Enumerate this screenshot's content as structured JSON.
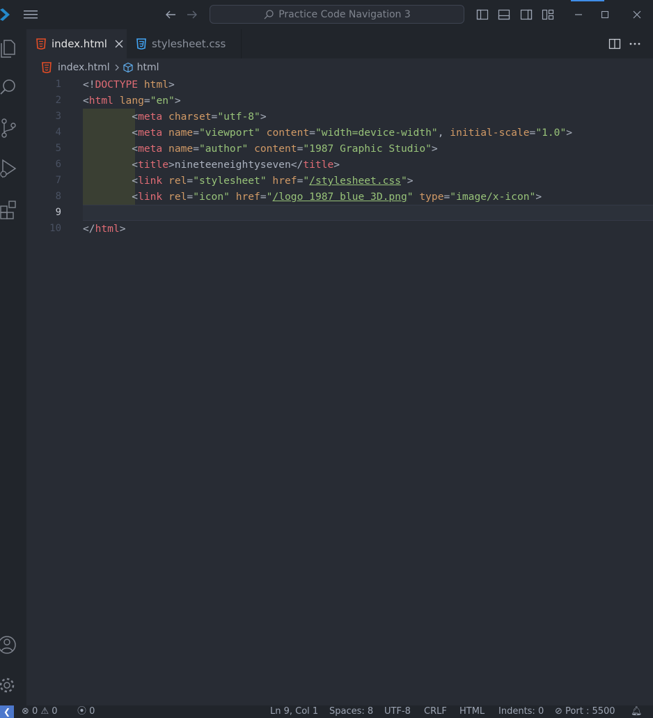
{
  "titlebar": {
    "command_center": "Practice Code Navigation 3"
  },
  "tabs": [
    {
      "label": "index.html",
      "icon": "html5-icon",
      "active": true
    },
    {
      "label": "stylesheet.css",
      "icon": "css3-icon",
      "active": false
    }
  ],
  "breadcrumb": {
    "file": "index.html",
    "symbol": "html"
  },
  "editor": {
    "current_line": 9,
    "lines": [
      {
        "n": "1",
        "tokens": [
          {
            "t": "<!",
            "c": "pun"
          },
          {
            "t": "DOCTYPE",
            "c": "tag"
          },
          {
            "t": " ",
            "c": "pun"
          },
          {
            "t": "html",
            "c": "attr"
          },
          {
            "t": ">",
            "c": "pun"
          }
        ]
      },
      {
        "n": "2",
        "tokens": [
          {
            "t": "<",
            "c": "pun"
          },
          {
            "t": "html",
            "c": "tag"
          },
          {
            "t": " ",
            "c": "pun"
          },
          {
            "t": "lang",
            "c": "attr"
          },
          {
            "t": "=",
            "c": "pun"
          },
          {
            "t": "\"en\"",
            "c": "str"
          },
          {
            "t": ">",
            "c": "pun"
          }
        ]
      },
      {
        "n": "3",
        "tokens": [
          {
            "t": "        <",
            "c": "pun"
          },
          {
            "t": "meta",
            "c": "tag"
          },
          {
            "t": " ",
            "c": "pun"
          },
          {
            "t": "charset",
            "c": "attr"
          },
          {
            "t": "=",
            "c": "pun"
          },
          {
            "t": "\"utf-8\"",
            "c": "str"
          },
          {
            "t": ">",
            "c": "pun"
          }
        ]
      },
      {
        "n": "4",
        "tokens": [
          {
            "t": "        <",
            "c": "pun"
          },
          {
            "t": "meta",
            "c": "tag"
          },
          {
            "t": " ",
            "c": "pun"
          },
          {
            "t": "name",
            "c": "attr"
          },
          {
            "t": "=",
            "c": "pun"
          },
          {
            "t": "\"viewport\"",
            "c": "str"
          },
          {
            "t": " ",
            "c": "pun"
          },
          {
            "t": "content",
            "c": "attr"
          },
          {
            "t": "=",
            "c": "pun"
          },
          {
            "t": "\"width=device-width\"",
            "c": "str"
          },
          {
            "t": ", ",
            "c": "pun"
          },
          {
            "t": "initial-scale",
            "c": "attr"
          },
          {
            "t": "=",
            "c": "pun"
          },
          {
            "t": "\"1.0\"",
            "c": "str"
          },
          {
            "t": ">",
            "c": "pun"
          }
        ]
      },
      {
        "n": "5",
        "tokens": [
          {
            "t": "        <",
            "c": "pun"
          },
          {
            "t": "meta",
            "c": "tag"
          },
          {
            "t": " ",
            "c": "pun"
          },
          {
            "t": "name",
            "c": "attr"
          },
          {
            "t": "=",
            "c": "pun"
          },
          {
            "t": "\"author\"",
            "c": "str"
          },
          {
            "t": " ",
            "c": "pun"
          },
          {
            "t": "content",
            "c": "attr"
          },
          {
            "t": "=",
            "c": "pun"
          },
          {
            "t": "\"1987 Graphic Studio\"",
            "c": "str"
          },
          {
            "t": ">",
            "c": "pun"
          }
        ]
      },
      {
        "n": "6",
        "tokens": [
          {
            "t": "        <",
            "c": "pun"
          },
          {
            "t": "title",
            "c": "tag"
          },
          {
            "t": ">nineteeneightyseven</",
            "c": "pun"
          },
          {
            "t": "title",
            "c": "tag"
          },
          {
            "t": ">",
            "c": "pun"
          }
        ]
      },
      {
        "n": "7",
        "tokens": [
          {
            "t": "        <",
            "c": "pun"
          },
          {
            "t": "link",
            "c": "tag"
          },
          {
            "t": " ",
            "c": "pun"
          },
          {
            "t": "rel",
            "c": "attr"
          },
          {
            "t": "=",
            "c": "pun"
          },
          {
            "t": "\"stylesheet\"",
            "c": "str"
          },
          {
            "t": " ",
            "c": "pun"
          },
          {
            "t": "href",
            "c": "attr"
          },
          {
            "t": "=",
            "c": "pun"
          },
          {
            "t": "\"",
            "c": "str"
          },
          {
            "t": "/stylesheet.css",
            "c": "link"
          },
          {
            "t": "\"",
            "c": "str"
          },
          {
            "t": ">",
            "c": "pun"
          }
        ]
      },
      {
        "n": "8",
        "tokens": [
          {
            "t": "        <",
            "c": "pun"
          },
          {
            "t": "link",
            "c": "tag"
          },
          {
            "t": " ",
            "c": "pun"
          },
          {
            "t": "rel",
            "c": "attr"
          },
          {
            "t": "=",
            "c": "pun"
          },
          {
            "t": "\"icon\"",
            "c": "str"
          },
          {
            "t": " ",
            "c": "pun"
          },
          {
            "t": "href",
            "c": "attr"
          },
          {
            "t": "=",
            "c": "pun"
          },
          {
            "t": "\"",
            "c": "str"
          },
          {
            "t": "/logo 1987 blue 3D.png",
            "c": "link"
          },
          {
            "t": "\"",
            "c": "str"
          },
          {
            "t": " ",
            "c": "pun"
          },
          {
            "t": "type",
            "c": "attr"
          },
          {
            "t": "=",
            "c": "pun"
          },
          {
            "t": "\"image/x-icon\"",
            "c": "str"
          },
          {
            "t": ">",
            "c": "pun"
          }
        ]
      },
      {
        "n": "9",
        "tokens": []
      },
      {
        "n": "10",
        "tokens": [
          {
            "t": "</",
            "c": "pun"
          },
          {
            "t": "html",
            "c": "tag"
          },
          {
            "t": ">",
            "c": "pun"
          }
        ]
      }
    ]
  },
  "statusbar": {
    "errors": "0",
    "warnings": "0",
    "ports": "0",
    "position": "Ln 9, Col 1",
    "spaces": "Spaces: 8",
    "encoding": "UTF-8",
    "eol": "CRLF",
    "language": "HTML",
    "indents": "Indents: 0",
    "port": "Port : 5500"
  },
  "colors": {
    "accent": "#3f8ee8",
    "tag": "#e06c75",
    "attribute": "#d19a66",
    "string": "#98c379",
    "html_icon": "#e44d26",
    "css_icon": "#42a5f5"
  }
}
